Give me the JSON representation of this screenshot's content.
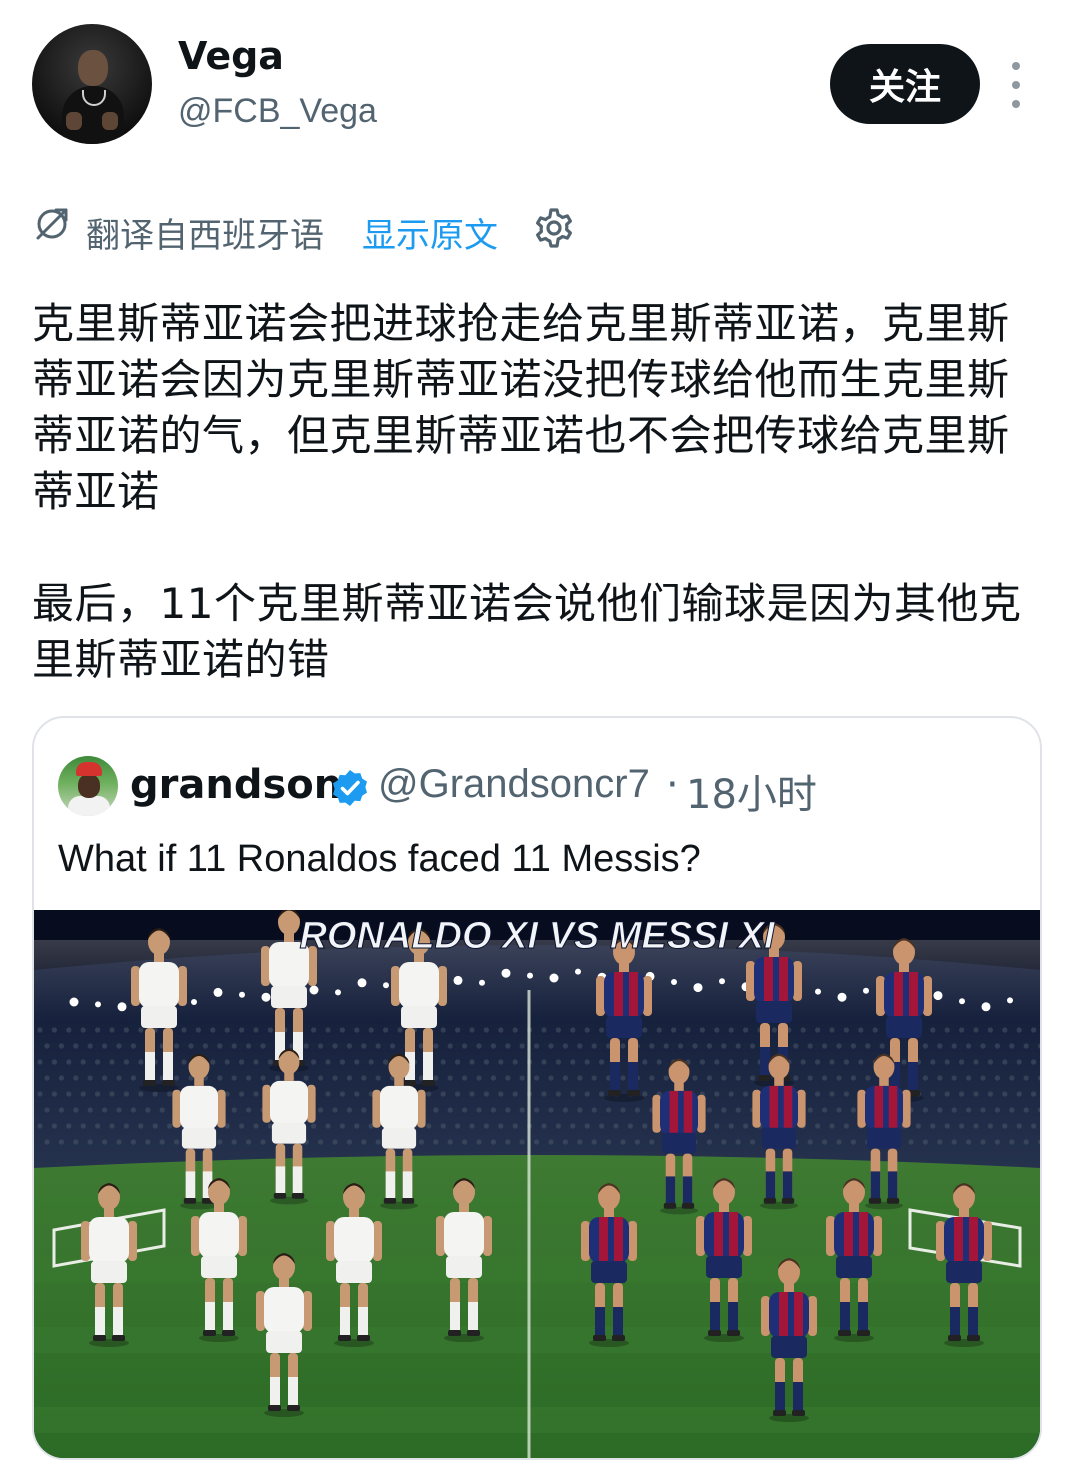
{
  "author": {
    "name": "Vega",
    "handle": "@FCB_Vega",
    "follow_label": "关注"
  },
  "translation": {
    "label": "翻译自西班牙语",
    "show_original": "显示原文"
  },
  "tweet": {
    "paragraphs": [
      "克里斯蒂亚诺会把进球抢走给克里斯蒂亚诺，克里斯蒂亚诺会因为克里斯蒂亚诺没把传球给他而生克里斯蒂亚诺的气，但克里斯蒂亚诺也不会把传球给克里斯蒂亚诺",
      "最后，11个克里斯蒂亚诺会说他们输球是因为其他克里斯蒂亚诺的错"
    ]
  },
  "quote": {
    "name": "grandson",
    "handle": "@Grandsoncr7",
    "separator": "·",
    "time": "18小时",
    "text": "What if 11 Ronaldos faced 11 Messis?",
    "image_title": "RONALDO XI VS MESSI XI"
  },
  "colors": {
    "text": "#0f1419",
    "secondary": "#536471",
    "link": "#1d9bf0",
    "follow_bg": "#0f1419",
    "border": "#dfe3e7",
    "real_kit": "#f4f4f2",
    "barca_blue": "#1e2f78",
    "barca_red": "#a3163a"
  },
  "icons": [
    "translate-icon",
    "gear-icon",
    "more-icon",
    "verified-icon"
  ]
}
